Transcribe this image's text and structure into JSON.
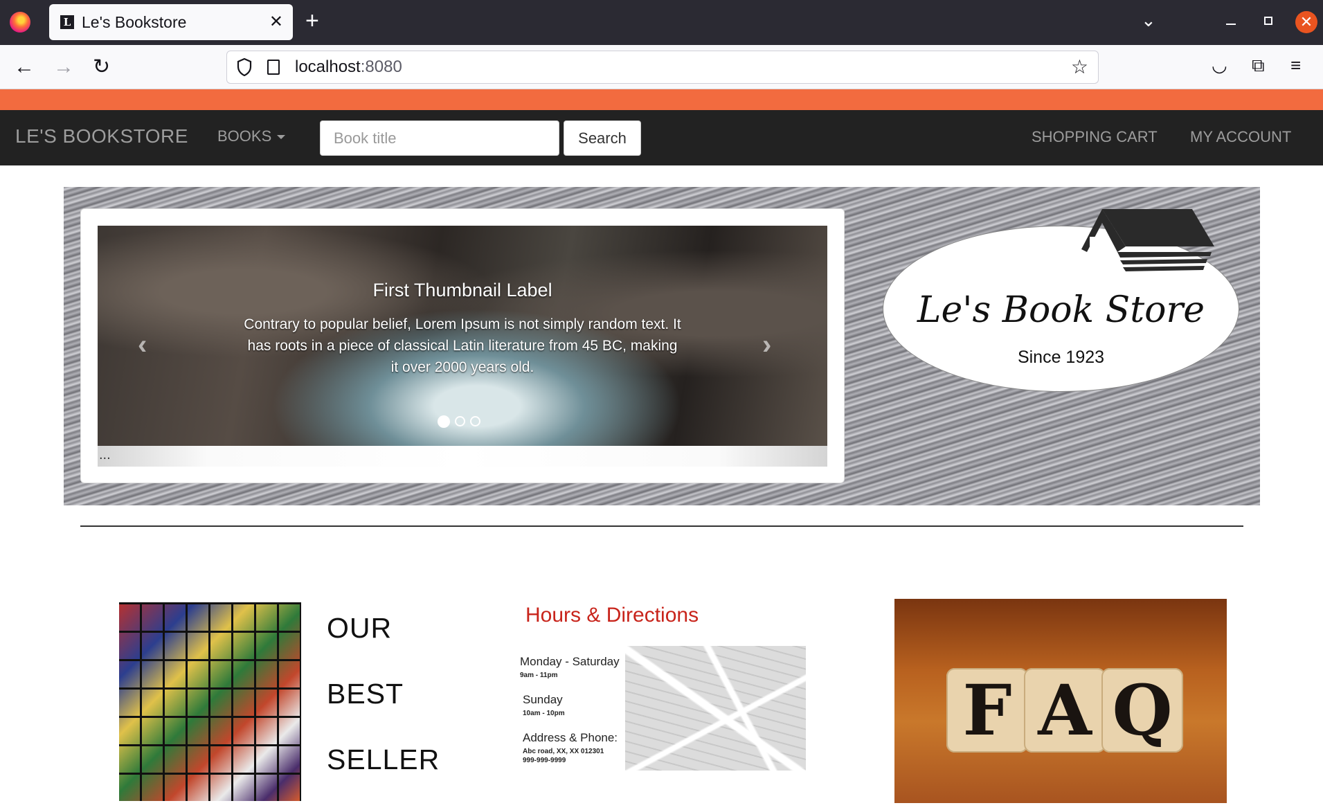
{
  "browser": {
    "tab_title": "Le's Bookstore",
    "tab_favicon": "L",
    "url_host": "localhost",
    "url_port": ":8080"
  },
  "nav": {
    "brand": "LE'S BOOKSTORE",
    "books": "BOOKS",
    "search_placeholder": "Book title",
    "search_button": "Search",
    "cart": "SHOPPING CART",
    "account": "MY ACCOUNT"
  },
  "carousel": {
    "title": "First Thumbnail Label",
    "text": "Contrary to popular belief, Lorem Ipsum is not simply random text. It has roots in a piece of classical Latin literature from 45 BC, making it over 2000 years old.",
    "slide_count": 3,
    "active_slide": 1,
    "footer_text": "..."
  },
  "logo": {
    "name": "Le's Book Store",
    "since": "Since 1923"
  },
  "bestseller": {
    "line1": "OUR",
    "line2": "BEST",
    "line3": "SELLER"
  },
  "hours": {
    "title": "Hours & Directions",
    "weekday_label": "Monday - Saturday",
    "weekday_hours": "9am - 11pm",
    "sunday_label": "Sunday",
    "sunday_hours": "10am - 10pm",
    "address_label": "Address & Phone:",
    "address": "Abc road, XX, XX 012301",
    "phone": "999-999-9999"
  },
  "faq": {
    "letters": [
      "F",
      "A",
      "Q"
    ]
  },
  "colors": {
    "accent_strip": "#f26b3f",
    "navbar": "#222222",
    "hours_title": "#c8241b"
  }
}
